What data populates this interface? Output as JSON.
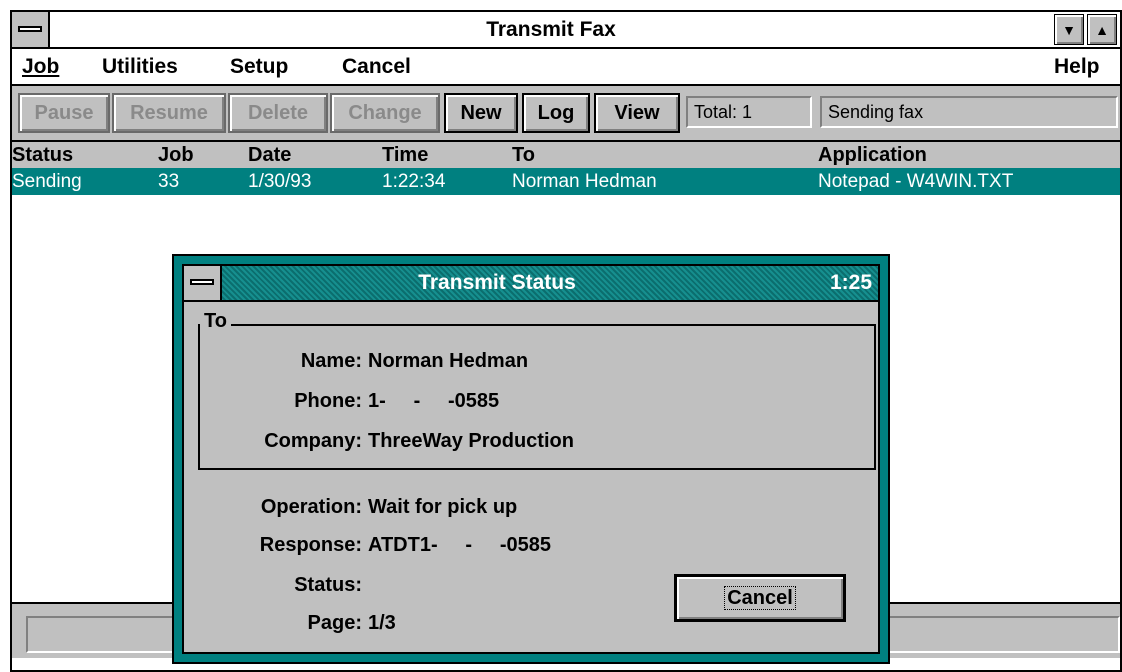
{
  "window": {
    "title": "Transmit Fax"
  },
  "menu": {
    "items": [
      "Job",
      "Utilities",
      "Setup",
      "Cancel"
    ],
    "help": "Help"
  },
  "toolbar": {
    "buttons": [
      {
        "label": "Pause",
        "enabled": false
      },
      {
        "label": "Resume",
        "enabled": false
      },
      {
        "label": "Delete",
        "enabled": false
      },
      {
        "label": "Change",
        "enabled": false
      },
      {
        "label": "New",
        "enabled": true
      },
      {
        "label": "Log",
        "enabled": true
      },
      {
        "label": "View",
        "enabled": true
      }
    ],
    "total": "Total: 1",
    "status": "Sending fax"
  },
  "list": {
    "columns": [
      "Status",
      "Job",
      "Date",
      "Time",
      "To",
      "Application"
    ],
    "rows": [
      [
        "Sending",
        "33",
        "1/30/93",
        "1:22:34",
        "Norman Hedman",
        "Notepad - W4WIN.TXT"
      ]
    ]
  },
  "dialog": {
    "title": "Transmit Status",
    "elapsed": "1:25",
    "group_label": "To",
    "labels": {
      "name": "Name:",
      "phone": "Phone:",
      "company": "Company:",
      "operation": "Operation:",
      "response": "Response:",
      "status": "Status:",
      "page": "Page:"
    },
    "values": {
      "name": "Norman Hedman",
      "phone": "1-     -     -0585",
      "company": "ThreeWay Production",
      "operation": "Wait for pick up",
      "response": "ATDT1-     -     -0585",
      "status": "",
      "page": "1/3"
    },
    "cancel_label": "Cancel"
  },
  "colors": {
    "highlight": "#008080",
    "face": "#c0c0c0",
    "dialog_frame": "#008080"
  },
  "icons": {
    "system_menu": "system-menu-icon",
    "minimize": "down-arrow-icon",
    "maximize": "up-arrow-icon"
  }
}
